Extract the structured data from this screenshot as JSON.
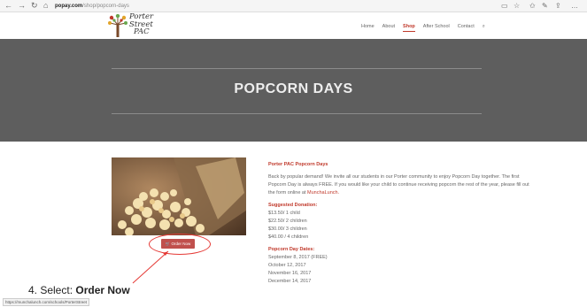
{
  "browser": {
    "url_domain": "popay.com",
    "url_path": "/shop/popcorn-days",
    "back_icon": "back-arrow-icon",
    "forward_icon": "forward-arrow-icon",
    "refresh_icon": "refresh-icon",
    "home_icon": "home-icon"
  },
  "site": {
    "logo_line1": "Porter",
    "logo_line2": "Street",
    "logo_line3": "PAC",
    "nav": [
      "Home",
      "About",
      "Shop",
      "After School",
      "Contact"
    ],
    "active_nav": "Shop",
    "search_icon": "search-icon"
  },
  "hero": {
    "title": "POPCORN DAYS"
  },
  "product": {
    "image_desc": "popcorn",
    "order_button": "Order Now",
    "cart_icon": "cart-icon"
  },
  "description": {
    "heading": "Porter PAC Popcorn Days",
    "intro": "Back by popular demand! We invite all our students in our Porter community to enjoy Popcorn Day together. The first Popcorn Day is always FREE. If you would like your child to continue receiving popcorn the rest of the year, please fill out the form online at",
    "link_text": "MunchaLunch.",
    "donation_heading": "Suggested Donation:",
    "donations": [
      "$13.50/ 1 child",
      "$22.50/ 2 children",
      "$30.00/ 3 children",
      "$40.00 / 4 children"
    ],
    "dates_heading": "Popcorn Day Dates:",
    "dates": [
      "September 8, 2017 (FREE)",
      "October 12, 2017",
      "November 16, 2017",
      "December 14, 2017"
    ]
  },
  "annotation": {
    "prefix": "4. Select:",
    "target": "Order Now"
  },
  "status_bar": {
    "url": "https://munchalunch.com/schools/PorterStreet"
  }
}
